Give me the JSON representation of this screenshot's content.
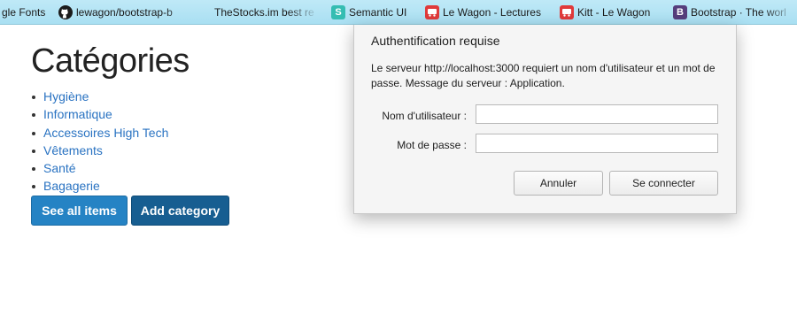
{
  "bookmarks": [
    {
      "label": "gle Fonts",
      "icon": "google-fonts-icon"
    },
    {
      "label": "lewagon/bootstrap-b",
      "icon": "github-icon"
    },
    {
      "label": "TheStocks.im best re",
      "icon": ""
    },
    {
      "label": "Semantic UI",
      "icon": "semantic-ui-icon",
      "glyph": "S"
    },
    {
      "label": "Le Wagon - Lectures",
      "icon": "le-wagon-icon"
    },
    {
      "label": "Kitt - Le Wagon",
      "icon": "kitt-icon"
    },
    {
      "label": "Bootstrap · The worl",
      "icon": "bootstrap-icon",
      "glyph": "B"
    }
  ],
  "page": {
    "title": "Catégories",
    "categories": [
      "Hygiène",
      "Informatique",
      "Accessoires High Tech",
      "Vêtements",
      "Santé",
      "Bagagerie"
    ],
    "buttons": {
      "see_all": "See all items",
      "add": "Add category"
    }
  },
  "dialog": {
    "title": "Authentification requise",
    "message": "Le serveur http://localhost:3000 requiert un nom d'utilisateur et un mot de passe. Message du serveur : Application.",
    "username_label": "Nom d'utilisateur :",
    "password_label": "Mot de passe :",
    "username_value": "",
    "password_value": "",
    "cancel_label": "Annuler",
    "connect_label": "Se connecter"
  },
  "colors": {
    "bookmarks_bar": "#a9dff2",
    "link": "#2a73c2",
    "primary_button": "#2583c4",
    "dark_button": "#175e91"
  }
}
